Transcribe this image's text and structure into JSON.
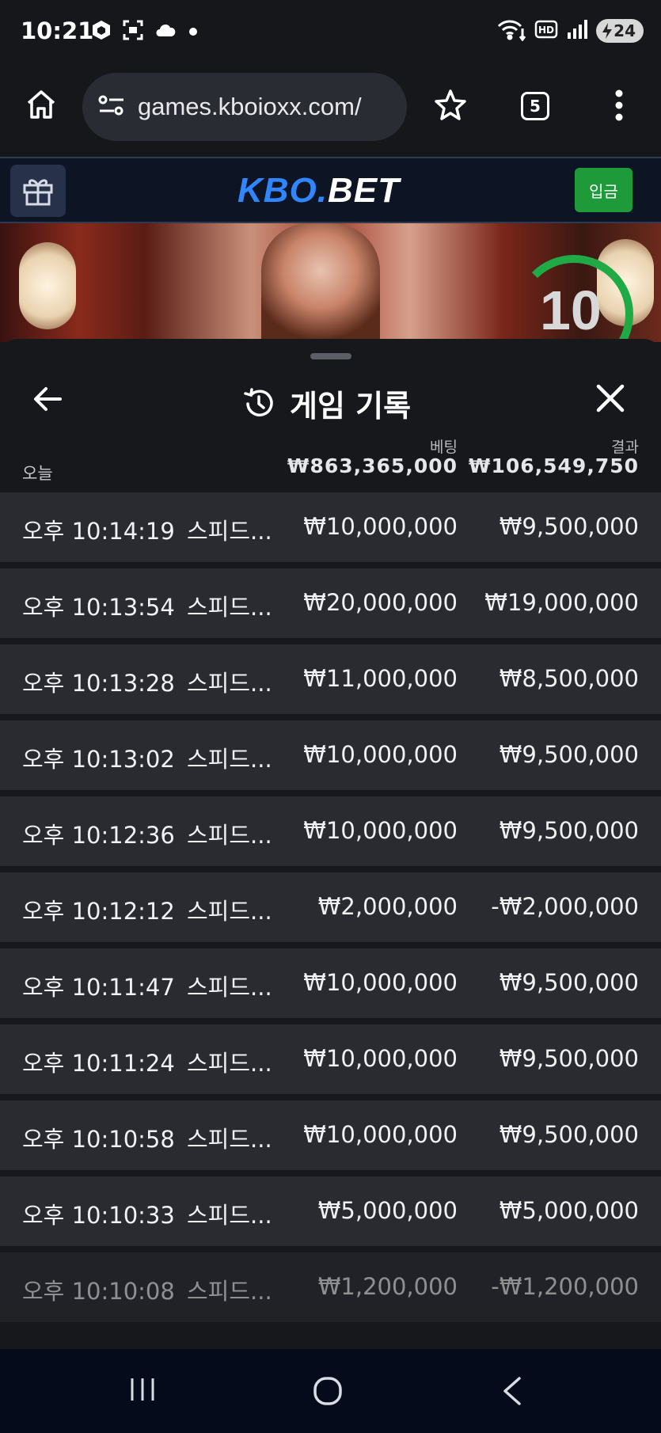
{
  "status_bar": {
    "time": "10:21",
    "left_icons": [
      "package-icon",
      "screenshot-icon",
      "cloud-icon",
      "dot-icon"
    ],
    "right_icons": [
      "wifi-icon",
      "hd-voice-icon",
      "signal-icon",
      "battery-icon"
    ],
    "battery_level": "24"
  },
  "browser": {
    "url": "games.kboioxx.com/",
    "tab_count": "5"
  },
  "site_header": {
    "logo_part1": "KBO.",
    "logo_part2": "BET",
    "deposit_label": "입금"
  },
  "video": {
    "countdown": "10"
  },
  "history": {
    "title": "게임 기록",
    "today_label": "오늘",
    "bet_label": "베팅",
    "result_label": "결과",
    "total_bet": "₩863,365,000",
    "total_result": "₩106,549,750",
    "rows": [
      {
        "time": "오후 10:14:19",
        "game": "스피드...",
        "bet": "₩10,000,000",
        "result": "₩9,500,000"
      },
      {
        "time": "오후 10:13:54",
        "game": "스피드...",
        "bet": "₩20,000,000",
        "result": "₩19,000,000"
      },
      {
        "time": "오후 10:13:28",
        "game": "스피드...",
        "bet": "₩11,000,000",
        "result": "₩8,500,000"
      },
      {
        "time": "오후 10:13:02",
        "game": "스피드...",
        "bet": "₩10,000,000",
        "result": "₩9,500,000"
      },
      {
        "time": "오후 10:12:36",
        "game": "스피드...",
        "bet": "₩10,000,000",
        "result": "₩9,500,000"
      },
      {
        "time": "오후 10:12:12",
        "game": "스피드...",
        "bet": "₩2,000,000",
        "result": "-₩2,000,000"
      },
      {
        "time": "오후 10:11:47",
        "game": "스피드...",
        "bet": "₩10,000,000",
        "result": "₩9,500,000"
      },
      {
        "time": "오후 10:11:24",
        "game": "스피드...",
        "bet": "₩10,000,000",
        "result": "₩9,500,000"
      },
      {
        "time": "오후 10:10:58",
        "game": "스피드...",
        "bet": "₩10,000,000",
        "result": "₩9,500,000"
      },
      {
        "time": "오후 10:10:33",
        "game": "스피드...",
        "bet": "₩5,000,000",
        "result": "₩5,000,000"
      },
      {
        "time": "오후 10:10:08",
        "game": "스피드...",
        "bet": "₩1,200,000",
        "result": "-₩1,200,000"
      }
    ]
  },
  "colors": {
    "accent_blue": "#2f86ff",
    "deposit_green": "#1f9a3a",
    "countdown_green": "#1faa45",
    "row_bg": "#2a2b30"
  }
}
